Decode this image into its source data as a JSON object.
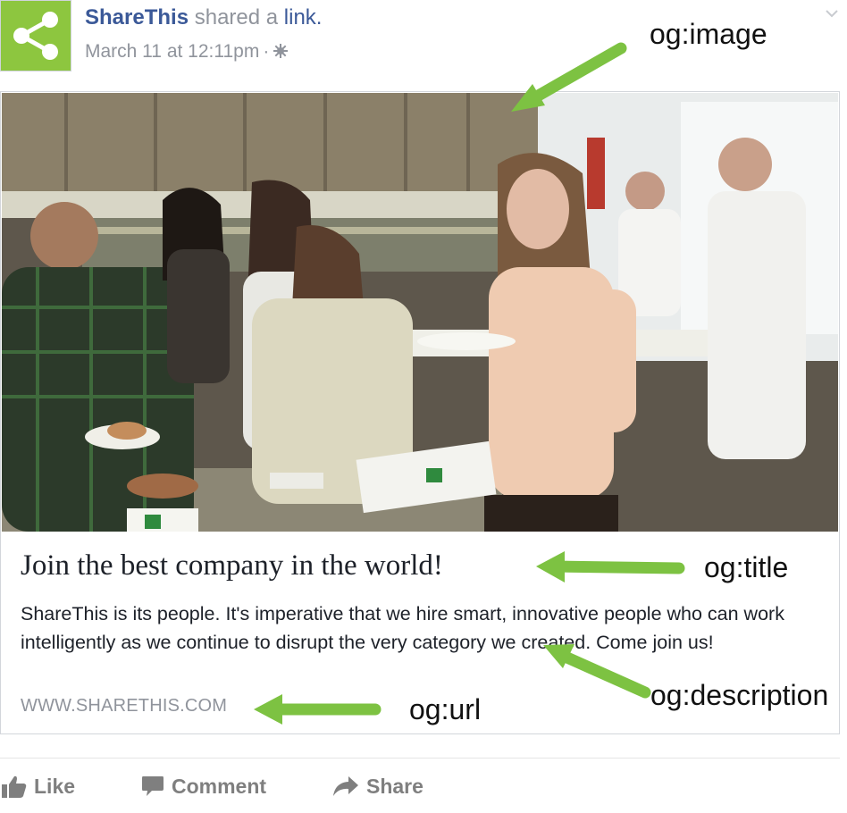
{
  "post": {
    "author": "ShareThis",
    "verb": "shared a",
    "link_word": "link.",
    "timestamp": "March 11 at 12:11pm",
    "separator": "·"
  },
  "card": {
    "title": "Join the best company in the world!",
    "description": "ShareThis is its people. It's imperative that we hire smart, innovative people who can work intelligently as we continue to disrupt the very category we created. Come join us!",
    "url": "WWW.SHARETHIS.COM"
  },
  "annotations": {
    "image": "og:image",
    "title": "og:title",
    "description": "og:description",
    "url": "og:url"
  },
  "actions": {
    "like": "Like",
    "comment": "Comment",
    "share": "Share"
  },
  "colors": {
    "brand_green": "#8dc63f",
    "link_blue": "#3b5998",
    "meta_gray": "#90949c",
    "arrow_green": "#7dc242"
  },
  "icons": [
    "share-logo-icon",
    "globe-icon",
    "chevron-down-icon",
    "like-icon",
    "comment-icon",
    "share-arrow-icon"
  ]
}
